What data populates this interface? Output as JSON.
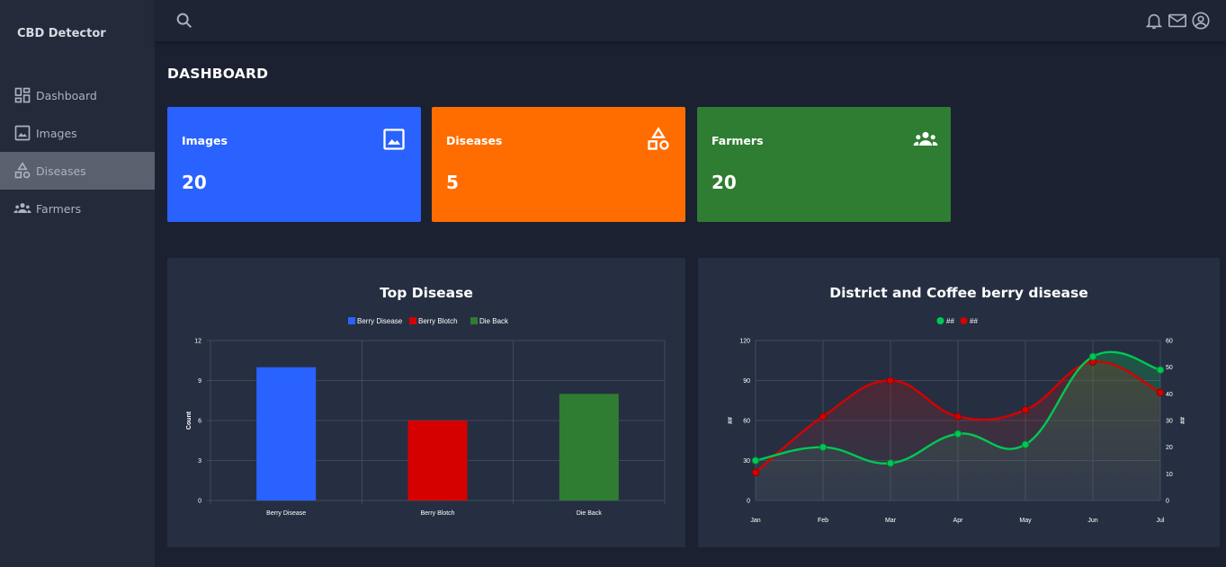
{
  "sidebar": {
    "brand": "CBD Detector",
    "items": [
      {
        "label": "Dashboard",
        "icon": "dashboard-icon"
      },
      {
        "label": "Images",
        "icon": "image-icon"
      },
      {
        "label": "Diseases",
        "icon": "shapes-icon",
        "active": true
      },
      {
        "label": "Farmers",
        "icon": "group-icon"
      }
    ]
  },
  "topbar": {
    "icons": [
      "search-icon",
      "bell-icon",
      "mail-icon",
      "account-icon"
    ]
  },
  "page_title": "DASHBOARD",
  "cards": [
    {
      "label": "Images",
      "value": "20",
      "color": "#2962ff",
      "icon": "image-icon"
    },
    {
      "label": "Diseases",
      "value": "5",
      "color": "#ff6d00",
      "icon": "shapes-icon"
    },
    {
      "label": "Farmers",
      "value": "20",
      "color": "#2e7d32",
      "icon": "group-icon"
    }
  ],
  "chart_data": [
    {
      "type": "bar",
      "title": "Top Disease",
      "categories": [
        "Berry Disease",
        "Berry Blotch",
        "Die Back"
      ],
      "values": [
        10,
        6,
        8
      ],
      "colors": [
        "#2962ff",
        "#d50000",
        "#2e7d32"
      ],
      "legend": [
        "Berry Disease",
        "Berry Blotch",
        "Die Back"
      ],
      "legend_position": "top",
      "ylabel": "Count",
      "ylim": [
        0,
        12
      ],
      "yticks": [
        0,
        3,
        6,
        9,
        12
      ],
      "grid": true
    },
    {
      "type": "line",
      "title": "District and Coffee berry disease",
      "categories": [
        "Jan",
        "Feb",
        "Mar",
        "Apr",
        "May",
        "Jun",
        "Jul"
      ],
      "series": [
        {
          "name": "##",
          "axis": "right",
          "color": "#00c853",
          "values": [
            15,
            20,
            14,
            25,
            21,
            54,
            49
          ]
        },
        {
          "name": "##",
          "axis": "left",
          "color": "#d50000",
          "values": [
            21,
            63,
            90,
            63,
            68,
            104,
            81
          ]
        }
      ],
      "ylabel_left": "##",
      "ylabel_right": "##",
      "ylim_left": [
        0,
        120
      ],
      "yticks_left": [
        0,
        30,
        60,
        90,
        120
      ],
      "ylim_right": [
        0,
        60
      ],
      "yticks_right": [
        0,
        10,
        20,
        30,
        40,
        50,
        60
      ],
      "legend_position": "top",
      "grid": true
    }
  ]
}
